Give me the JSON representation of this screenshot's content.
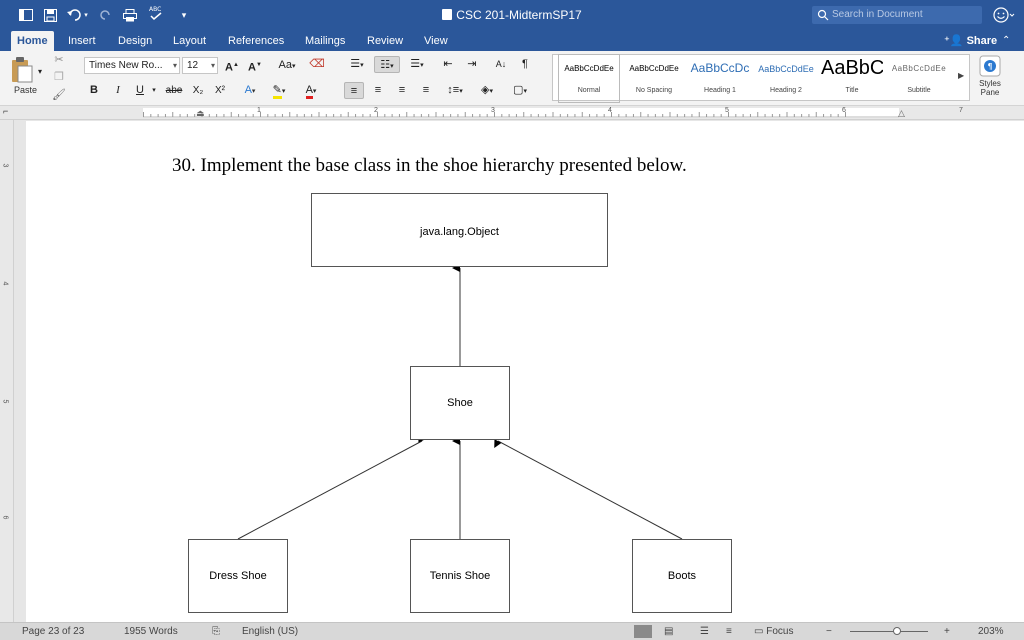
{
  "window": {
    "title": "CSC 201-MidtermSP17",
    "search_placeholder": "Search in Document"
  },
  "tabs": [
    {
      "label": "Home",
      "active": true
    },
    {
      "label": "Insert"
    },
    {
      "label": "Design"
    },
    {
      "label": "Layout"
    },
    {
      "label": "References"
    },
    {
      "label": "Mailings"
    },
    {
      "label": "Review"
    },
    {
      "label": "View"
    }
  ],
  "share_label": "Share",
  "ribbon": {
    "paste_label": "Paste",
    "font_name": "Times New Ro...",
    "font_size": "12",
    "bold": "B",
    "italic": "I",
    "underline": "U",
    "strikethrough": "abe",
    "subscript": "X₂",
    "superscript": "X²",
    "pilcrow": "¶",
    "styles": [
      {
        "sample": "AaBbCcDdEe",
        "name": "Normal",
        "selected": true
      },
      {
        "sample": "AaBbCcDdEe",
        "name": "No Spacing"
      },
      {
        "sample": "AaBbCcDc",
        "name": "Heading 1"
      },
      {
        "sample": "AaBbCcDdEe",
        "name": "Heading 2"
      },
      {
        "sample": "AaBbC",
        "name": "Title"
      },
      {
        "sample": "AaBbCcDdEe",
        "name": "Subtitle"
      }
    ],
    "styles_pane": "Styles Pane"
  },
  "ruler": {
    "h_numbers": [
      "1",
      "2",
      "3",
      "4",
      "5",
      "6",
      "7"
    ],
    "v_numbers": [
      "3",
      "4",
      "5",
      "6"
    ]
  },
  "document": {
    "question": "30. Implement the base class in the shoe hierarchy presented below.",
    "diagram": {
      "root": "java.lang.Object",
      "base": "Shoe",
      "children": [
        "Dress Shoe",
        "Tennis Shoe",
        "Boots"
      ]
    }
  },
  "statusbar": {
    "page": "Page 23 of 23",
    "words": "1955 Words",
    "language": "English (US)",
    "focus": "Focus",
    "zoom": "203%"
  },
  "colors": {
    "title_bar": "#2b579a",
    "ribbon_bg": "#f3f3f3",
    "status_bg": "#d8d8d8"
  }
}
